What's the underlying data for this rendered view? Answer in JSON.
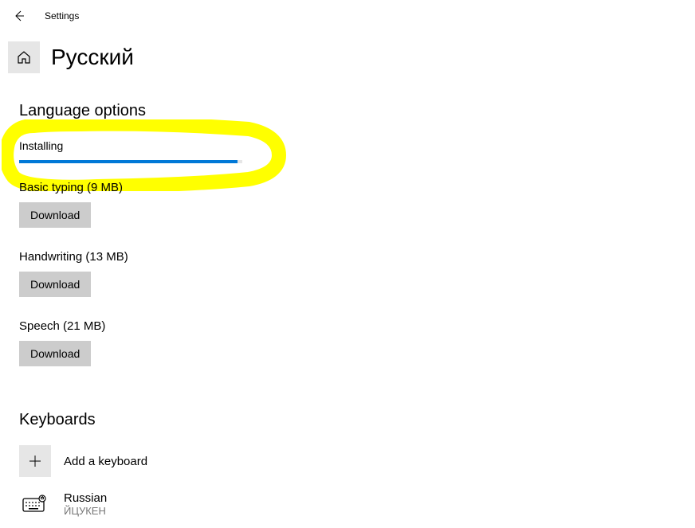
{
  "header": {
    "app_title": "Settings"
  },
  "page": {
    "title": "Русский",
    "section_language_options": "Language options",
    "section_keyboards": "Keyboards"
  },
  "installing": {
    "label": "Installing",
    "progress_percent": 98
  },
  "features": {
    "basic_typing": {
      "label": "Basic typing (9 MB)",
      "button": "Download"
    },
    "handwriting": {
      "label": "Handwriting (13 MB)",
      "button": "Download"
    },
    "speech": {
      "label": "Speech (21 MB)",
      "button": "Download"
    }
  },
  "keyboards": {
    "add_label": "Add a keyboard",
    "items": [
      {
        "name": "Russian",
        "layout": "ЙЦУКЕН"
      }
    ]
  }
}
